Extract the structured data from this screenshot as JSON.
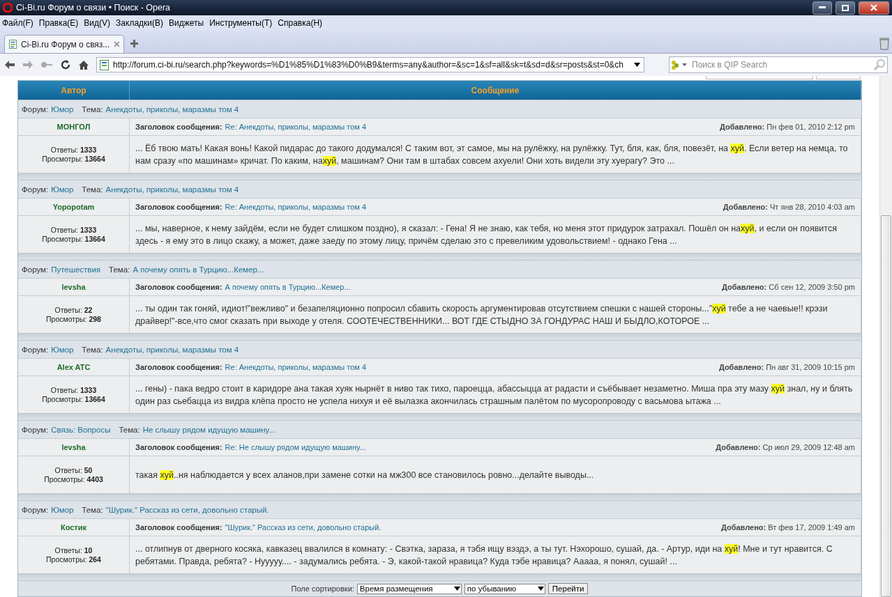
{
  "window": {
    "title": "Ci-Bi.ru Форум о связи • Поиск - Opera"
  },
  "menu": [
    "Файл(F)",
    "Правка(E)",
    "Вид(V)",
    "Закладки(B)",
    "Виджеты",
    "Инструменты(T)",
    "Справка(H)"
  ],
  "tabs": [
    {
      "label": "Ci-Bi.ru Форум о связ...",
      "selected": true
    }
  ],
  "address_bar": {
    "url": "http://forum.ci-bi.ru/search.php?keywords=%D1%85%D1%83%D0%B9&terms=any&author=&sc=1&sf=all&sk=t&sd=d&sr=posts&st=0&ch"
  },
  "search": {
    "placeholder": "Поиск в QIP Search"
  },
  "table": {
    "columns": [
      "Автор",
      "Сообщение"
    ],
    "results": [
      {
        "forum_label": "Форум:",
        "forum": "Юмор",
        "topic_label": "Тема:",
        "topic": "Анекдоты, приколы, маразмы том 4",
        "author": "МОНГОЛ",
        "subject_label": "Заголовок сообщения:",
        "subject": "Re: Анекдоты, приколы, маразмы том 4",
        "added_label": "Добавлено:",
        "added": "Пн фев 01, 2010 2:12 pm",
        "replies_label": "Ответы:",
        "replies": "1333",
        "views_label": "Просмотры:",
        "views": "13664",
        "segments": [
          {
            "text": "... Ёб твою мать! Какая вонь! Какой пидарас до такого додумался! С таким вот, эт самое, мы на рулёжку, на рулёжку. Тут, бля, как, бля, повезёт, на ",
            "highlighted": false
          },
          {
            "text": "хуй",
            "highlighted": true
          },
          {
            "text": ". Если ветер на немца, то нам сразу «по машинам» кричат. По каким, на",
            "highlighted": false
          },
          {
            "text": "хуй",
            "highlighted": true
          },
          {
            "text": ", машинам? Они там в штабах совсем ахуели! Они хоть видели эту хуерагу? Это ...",
            "highlighted": false
          }
        ]
      },
      {
        "forum_label": "Форум:",
        "forum": "Юмор",
        "topic_label": "Тема:",
        "topic": "Анекдоты, приколы, маразмы том 4",
        "author": "Yopopotam",
        "subject_label": "Заголовок сообщения:",
        "subject": "Re: Анекдоты, приколы, маразмы том 4",
        "added_label": "Добавлено:",
        "added": "Чт янв 28, 2010 4:03 am",
        "replies_label": "Ответы:",
        "replies": "1333",
        "views_label": "Просмотры:",
        "views": "13664",
        "segments": [
          {
            "text": "... мы, наверное, к нему зайдём, если не будет слишком поздно), я сказал: - Гена! Я не знаю, как тебя, но меня этот придурок затрахал. Пошёл он на",
            "highlighted": false
          },
          {
            "text": "хуй",
            "highlighted": true
          },
          {
            "text": ", и если он появится здесь - я ему это в лицо скажу, а может, даже заеду по этому лицу, причём сделаю это с превеликим удовольствием! - однако Гена ...",
            "highlighted": false
          }
        ]
      },
      {
        "forum_label": "Форум:",
        "forum": "Путешествия",
        "topic_label": "Тема:",
        "topic": "А почему опять в Турцию...Кемер...",
        "author": "levsha",
        "subject_label": "Заголовок сообщения:",
        "subject": "А почему опять в Турцию...Кемер...",
        "added_label": "Добавлено:",
        "added": "Сб сен 12, 2009 3:50 pm",
        "replies_label": "Ответы:",
        "replies": "22",
        "views_label": "Просмотры:",
        "views": "298",
        "segments": [
          {
            "text": "... ты один так гоняй, идиот!\"вежливо\" и безапеляционно попросил сбавить скорость аргументировав отсутствием спешки с нашей стороны...\"",
            "highlighted": false
          },
          {
            "text": "хуй",
            "highlighted": true
          },
          {
            "text": " тебе а не чаевые!! крэзи драйвер!\"-все,что смог сказать при выходе у отеля. СООТЕЧЕСТВЕННИКИ... ВОТ ГДЕ СТЫДНО ЗА ГОНДУРАС НАШ И БЫДЛО,КОТОРОЕ ...",
            "highlighted": false
          }
        ]
      },
      {
        "forum_label": "Форум:",
        "forum": "Юмор",
        "topic_label": "Тема:",
        "topic": "Анекдоты, приколы, маразмы том 4",
        "author": "Alex ATC",
        "subject_label": "Заголовок сообщения:",
        "subject": "Re: Анекдоты, приколы, маразмы том 4",
        "added_label": "Добавлено:",
        "added": "Пн авг 31, 2009 10:15 pm",
        "replies_label": "Ответы:",
        "replies": "1333",
        "views_label": "Просмотры:",
        "views": "13664",
        "segments": [
          {
            "text": "... гены) - пака ведро стоит в каридоре ана такая хуяк нырнёт в ниво так тихо, пароецца, абассыцца ат радасти и съёбывает незаметно. Миша пра эту мазу ",
            "highlighted": false
          },
          {
            "text": "хуй",
            "highlighted": true
          },
          {
            "text": " знал, ну и блять один раз сьебацца из видра клёпа просто не успела нихуя и её вылазка акончилась страшным палётом по мусоропроводу с васьмова ытажа ...",
            "highlighted": false
          }
        ]
      },
      {
        "forum_label": "Форум:",
        "forum": "Связь: Вопросы",
        "topic_label": "Тема:",
        "topic": "Не слышу рядом идущую машину...",
        "author": "levsha",
        "subject_label": "Заголовок сообщения:",
        "subject": "Re: Не слышу рядом идущую машину...",
        "added_label": "Добавлено:",
        "added": "Ср июл 29, 2009 12:48 am",
        "replies_label": "Ответы:",
        "replies": "50",
        "views_label": "Просмотры:",
        "views": "4403",
        "segments": [
          {
            "text": "такая ",
            "highlighted": false
          },
          {
            "text": "хуй",
            "highlighted": true
          },
          {
            "text": "..ня наблюдается у всех аланов,при замене сотки на мж300 все становилось ровно...делайте выводы...",
            "highlighted": false
          }
        ]
      },
      {
        "forum_label": "Форум:",
        "forum": "Юмор",
        "topic_label": "Тема:",
        "topic": "\"Шурик.\" Рассказ из сети, довольно старый.",
        "author": "Костик",
        "subject_label": "Заголовок сообщения:",
        "subject": "\"Шурик.\" Рассказ из сети, довольно старый.",
        "added_label": "Добавлено:",
        "added": "Вт фев 17, 2009 1:49 am",
        "replies_label": "Ответы:",
        "replies": "10",
        "views_label": "Просмотры:",
        "views": "264",
        "segments": [
          {
            "text": "... отлипнув от дверного косяка, кавказец ввалился в комнату: - Свэтка, зараза, я тэбя ищу вэздэ, а ты тут. Нэхорошо, сушай, да. - Артур, иди на ",
            "highlighted": false
          },
          {
            "text": "хуй",
            "highlighted": true
          },
          {
            "text": "! Мне и тут нравится. С ребятами. Правда, ребята? - Нууууу.... - задумались ребята. - Э, какой-такой нравица? Куда тэбе нравица? Ааааа, я понял, сушай! ...",
            "highlighted": false
          }
        ]
      }
    ]
  },
  "sort": {
    "label": "Поле сортировки:",
    "field": "Время размещения",
    "order": "по убыванию",
    "button": "Перейти"
  }
}
